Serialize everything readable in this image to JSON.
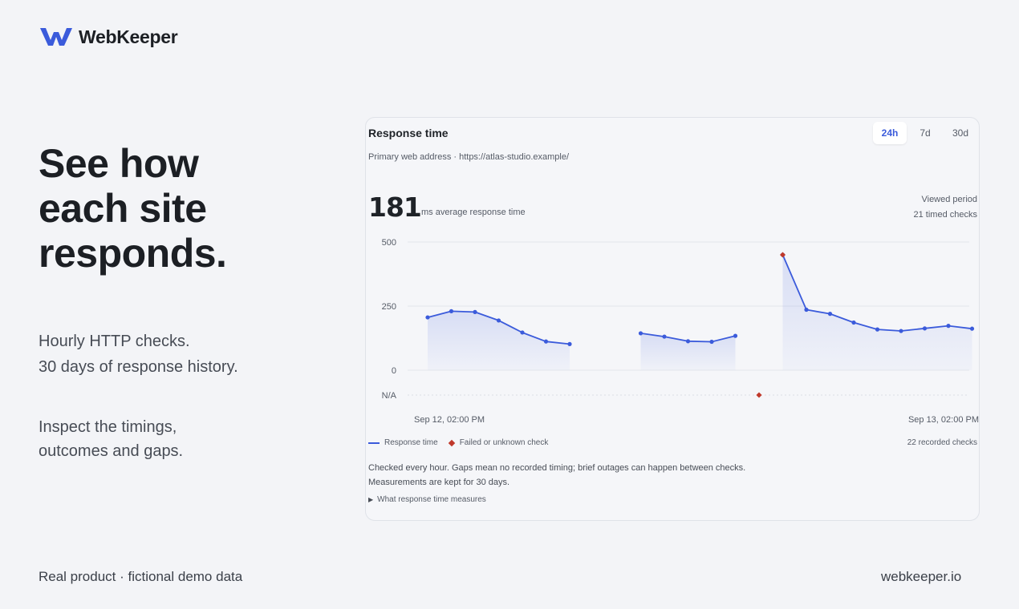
{
  "brand": {
    "name": "WebKeeper",
    "accent": "#3b5bdb"
  },
  "hero": {
    "lines": [
      "See how",
      "each site",
      "responds."
    ]
  },
  "intro": {
    "lines": [
      "Hourly HTTP checks.",
      "30 days of response history."
    ]
  },
  "detail": {
    "lines": [
      "Inspect the timings,",
      "outcomes and gaps."
    ]
  },
  "footer": {
    "left": "Real product · fictional demo data",
    "right": "webkeeper.io"
  },
  "card": {
    "title": "Response time",
    "subtitle": "Primary web address · https://atlas-studio.example/",
    "ranges": [
      {
        "label": "24h",
        "active": true
      },
      {
        "label": "7d",
        "active": false
      },
      {
        "label": "30d",
        "active": false
      }
    ],
    "average": "181",
    "average_label": "ms average response time",
    "period_label": "Viewed period",
    "timed_checks": "21 timed checks",
    "legend": {
      "line": "Response time",
      "failed": "Failed or unknown check"
    },
    "recorded_checks": "22 recorded checks",
    "note_lines": [
      "Checked every hour. Gaps mean no recorded timing; brief outages can happen between checks.",
      "Measurements are kept for 30 days."
    ],
    "details_label": "What response time measures"
  },
  "chart_data": {
    "type": "line",
    "series": [
      {
        "name": "Response time",
        "color": "#3b5bdb",
        "points": [
          {
            "x": 0,
            "y": 206
          },
          {
            "x": 1,
            "y": 230
          },
          {
            "x": 2,
            "y": 227
          },
          {
            "x": 3,
            "y": 194
          },
          {
            "x": 4,
            "y": 147
          },
          {
            "x": 5,
            "y": 112
          },
          {
            "x": 6,
            "y": 102
          },
          {
            "x": 9,
            "y": 144
          },
          {
            "x": 10,
            "y": 131
          },
          {
            "x": 11,
            "y": 113
          },
          {
            "x": 12,
            "y": 111
          },
          {
            "x": 13,
            "y": 134
          },
          {
            "x": 15,
            "y": 450
          },
          {
            "x": 16,
            "y": 236
          },
          {
            "x": 17,
            "y": 220
          },
          {
            "x": 18,
            "y": 186
          },
          {
            "x": 19,
            "y": 159
          },
          {
            "x": 20,
            "y": 153
          },
          {
            "x": 21,
            "y": 163
          },
          {
            "x": 22,
            "y": 173
          },
          {
            "x": 23,
            "y": 162
          }
        ],
        "segments": [
          [
            0,
            6
          ],
          [
            9,
            13
          ],
          [
            15,
            23
          ]
        ]
      }
    ],
    "failed_checks": [
      {
        "x": 14,
        "y": "N/A"
      },
      {
        "x": 15,
        "y": 450
      }
    ],
    "x_labels": [
      {
        "x": 0,
        "label": "Sep 12, 02:00 PM"
      },
      {
        "x": 24,
        "label": "Sep 13, 02:00 PM"
      }
    ],
    "y_ticks": [
      500,
      250,
      0
    ],
    "na_label": "N/A",
    "ylim": [
      0,
      500
    ],
    "grid": true
  }
}
